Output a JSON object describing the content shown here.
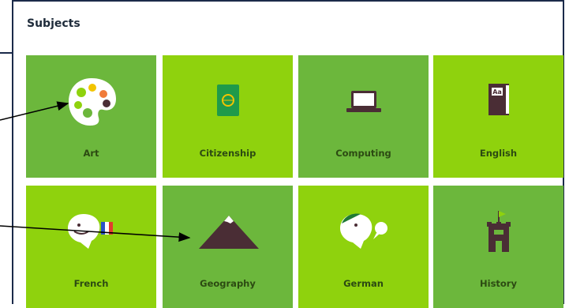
{
  "panel": {
    "title": "Subjects"
  },
  "subjects": [
    {
      "label": "Art",
      "icon": "palette-icon"
    },
    {
      "label": "Citizenship",
      "icon": "passport-icon"
    },
    {
      "label": "Computing",
      "icon": "laptop-icon"
    },
    {
      "label": "English",
      "icon": "book-icon"
    },
    {
      "label": "French",
      "icon": "french-speaker-icon"
    },
    {
      "label": "Geography",
      "icon": "mountain-icon"
    },
    {
      "label": "German",
      "icon": "german-speaker-icon"
    },
    {
      "label": "History",
      "icon": "castle-icon"
    }
  ],
  "colors": {
    "tile_dark": "#6cb73c",
    "tile_light": "#8fd20d",
    "icon_dark": "#4a2d35",
    "border": "#1b2a4a"
  }
}
